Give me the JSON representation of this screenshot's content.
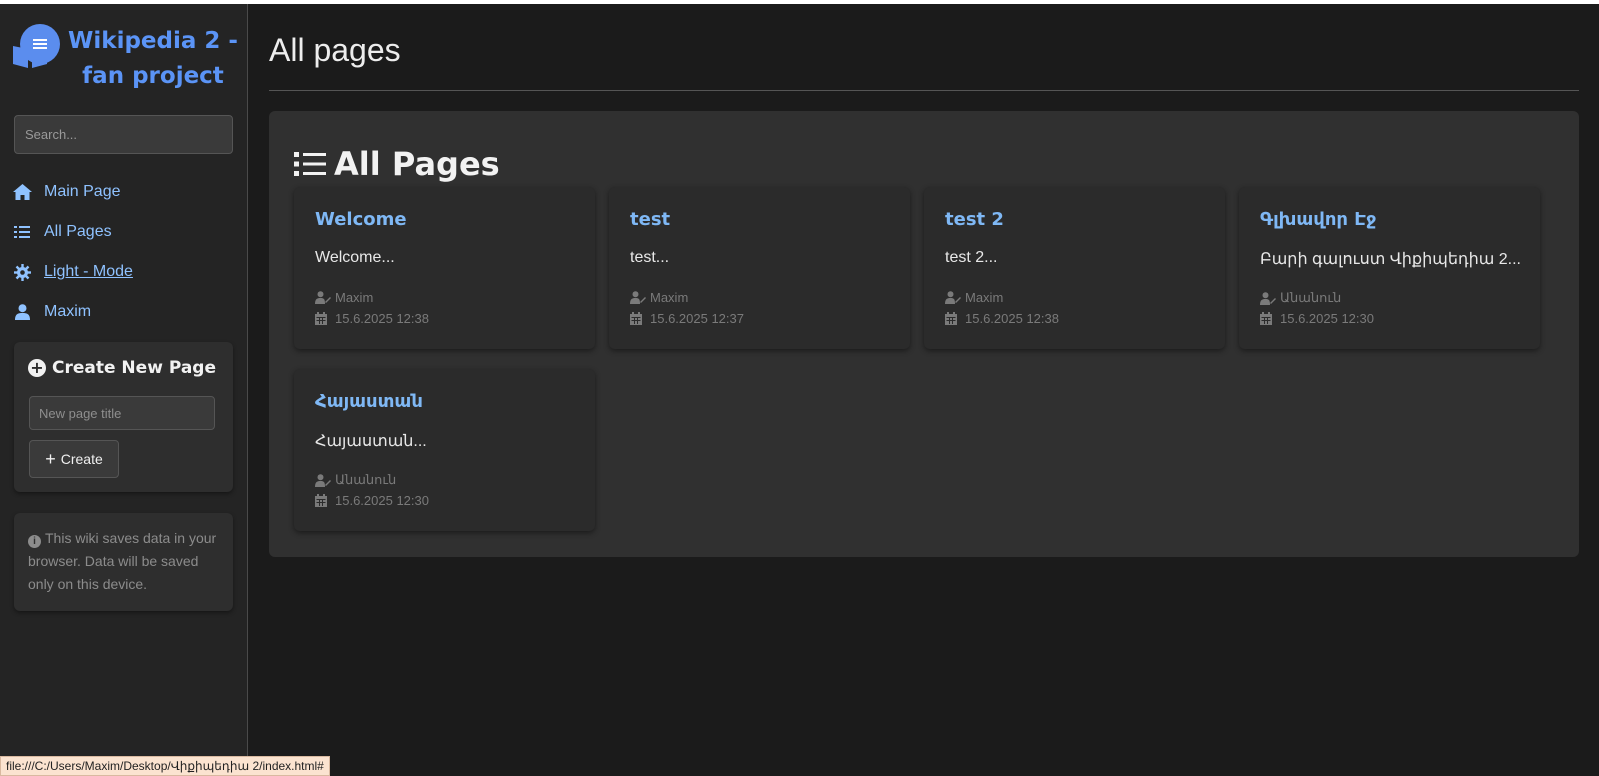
{
  "sidebar": {
    "brand": {
      "title": "Wikipedia 2 - fan project",
      "icon": "book-menu-icon",
      "color": "#5b94f6"
    },
    "search": {
      "placeholder": "Search..."
    },
    "nav": [
      {
        "label": "Main Page",
        "icon": "home-icon"
      },
      {
        "label": "All Pages",
        "icon": "list-icon"
      },
      {
        "label": "Light - Mode",
        "icon": "gear-icon"
      },
      {
        "label": "Maxim",
        "icon": "user-icon"
      }
    ],
    "create": {
      "title": "Create New Page",
      "input_placeholder": "New page title",
      "button_label": "Create"
    },
    "info": "This wiki saves data in your browser. Data will be saved only on this device."
  },
  "main": {
    "heading": "All pages",
    "panel_title": "All Pages",
    "pages": [
      {
        "title": "Welcome",
        "excerpt": "Welcome...",
        "author": "Maxim",
        "date": "15.6.2025 12:38"
      },
      {
        "title": "test",
        "excerpt": "test...",
        "author": "Maxim",
        "date": "15.6.2025 12:37"
      },
      {
        "title": "test 2",
        "excerpt": "test 2...",
        "author": "Maxim",
        "date": "15.6.2025 12:38"
      },
      {
        "title": "Գլխավոր Էջ",
        "excerpt": "Բարի գալուստ Վիքիպեդիա 2...",
        "author": "Անանուն",
        "date": "15.6.2025 12:30"
      },
      {
        "title": "Հայաստան",
        "excerpt": "Հայաստան...",
        "author": "Անանուն",
        "date": "15.6.2025 12:30"
      }
    ]
  },
  "status_bar": {
    "url": "file:///C:/Users/Maxim/Desktop/Վիքիպեդիա 2/index.html#"
  },
  "colors": {
    "background": "#1b1b1b",
    "link": "#8fc2ff",
    "card_title": "#7fb8f5",
    "panel": "#303030"
  }
}
